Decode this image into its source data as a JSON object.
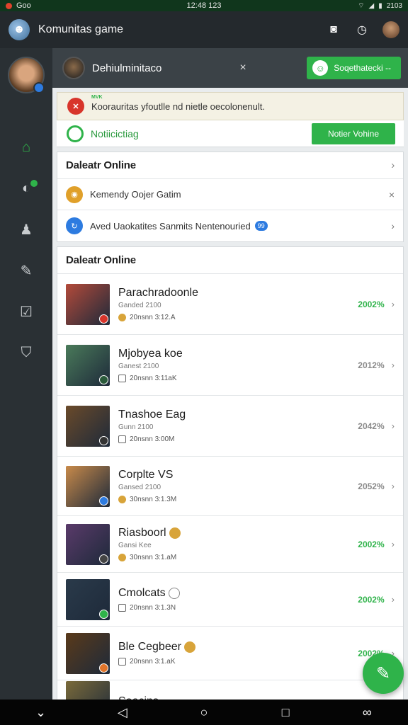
{
  "status_bar": {
    "left_label": "Goo",
    "time": "12:48 123",
    "right_label": "2103"
  },
  "app": {
    "title": "Komunitas game"
  },
  "header_icons": [
    "camera-icon",
    "clock-icon",
    "profile-avatar"
  ],
  "sidebar": {
    "items": [
      {
        "icon": "home-icon",
        "active": true
      },
      {
        "icon": "controller-icon",
        "active": false
      },
      {
        "icon": "users-icon",
        "active": false
      },
      {
        "icon": "edit-icon",
        "active": false
      },
      {
        "icon": "checklist-icon",
        "active": false
      },
      {
        "icon": "shield-icon",
        "active": false
      }
    ]
  },
  "topbar": {
    "name": "Dehiulminitaco",
    "close_glyph": "×",
    "button_label": "Soqethatecki -- "
  },
  "notice": {
    "tag": "MVK",
    "text": "Koorauritas yfoutlle nd nietle oecolonenult."
  },
  "notification": {
    "label": "Notiicictiag",
    "button_label": "Notier Vohine"
  },
  "card1": {
    "title": "Daleatr Online",
    "rows": [
      {
        "text": "Kemendy Oojer Gatim",
        "action": "×",
        "color": "#e0a02a"
      },
      {
        "text": "Aved Uaokatites Sanmits Nentenouried",
        "action": "›",
        "color": "#2d7be0",
        "badge": "99"
      }
    ]
  },
  "games": {
    "title": "Daleatr Online",
    "items": [
      {
        "name": "Parachradoonle",
        "sub": "Ganded 2100",
        "meta": "20nsnn 3:12.A",
        "score": "2002%",
        "score_color": "#2fb34a",
        "thumb": "#b34a3a",
        "badge": "#d8352b",
        "meta_gold": true
      },
      {
        "name": "Mjobyea koe",
        "sub": "Ganest 2100",
        "meta": "20nsnn 3:11aK",
        "score": "2012%",
        "score_color": "#888888",
        "thumb": "#4a7a5a",
        "badge": "#2a5a3a",
        "meta_gold": false
      },
      {
        "name": "Tnashoe Eag",
        "sub": "Gunn 2100",
        "meta": "20nsnn 3:00M",
        "score": "2042%",
        "score_color": "#888888",
        "thumb": "#6a4a2a",
        "badge": "#333333",
        "meta_gold": false,
        "sub_icon": true
      },
      {
        "name": "Corplte VS",
        "sub": "Gansed 2100",
        "meta": "30nsnn 3:1.3M",
        "score": "2052%",
        "score_color": "#888888",
        "thumb": "#c88a4a",
        "badge": "#2d7be0",
        "meta_gold": true
      },
      {
        "name": "Riasboorl",
        "sub": "Gansi Kee",
        "meta": "30nsnn 3:1.aM",
        "score": "2002%",
        "score_color": "#2fb34a",
        "thumb": "#5a3a6a",
        "badge": "#444444",
        "meta_gold": true,
        "name_badge": "gold"
      },
      {
        "name": "Cmolcats",
        "sub": "",
        "meta": "20nsnn 3:1.3N",
        "score": "2002%",
        "score_color": "#2fb34a",
        "thumb": "#2a3a4a",
        "badge": "#2fb34a",
        "meta_gold": false,
        "name_badge": "outline"
      },
      {
        "name": "Ble Cegbeer",
        "sub": "",
        "meta": "20nsnn 3:1.aK",
        "score": "2002%",
        "score_color": "#2fb34a",
        "thumb": "#5a3a1a",
        "badge": "#e0742a",
        "meta_gold": false,
        "name_badge": "gold"
      },
      {
        "name": "Soacins",
        "sub": "",
        "meta": "",
        "score": "",
        "score_color": "#888888",
        "thumb": "#7a6a3a",
        "badge": "#2d7be0",
        "meta_gold": false
      }
    ]
  },
  "fab": {
    "icon": "compose-icon"
  },
  "nav_bar": [
    "back-gesture-icon",
    "back-icon",
    "home-circle-icon",
    "recents-icon",
    "link-icon"
  ]
}
